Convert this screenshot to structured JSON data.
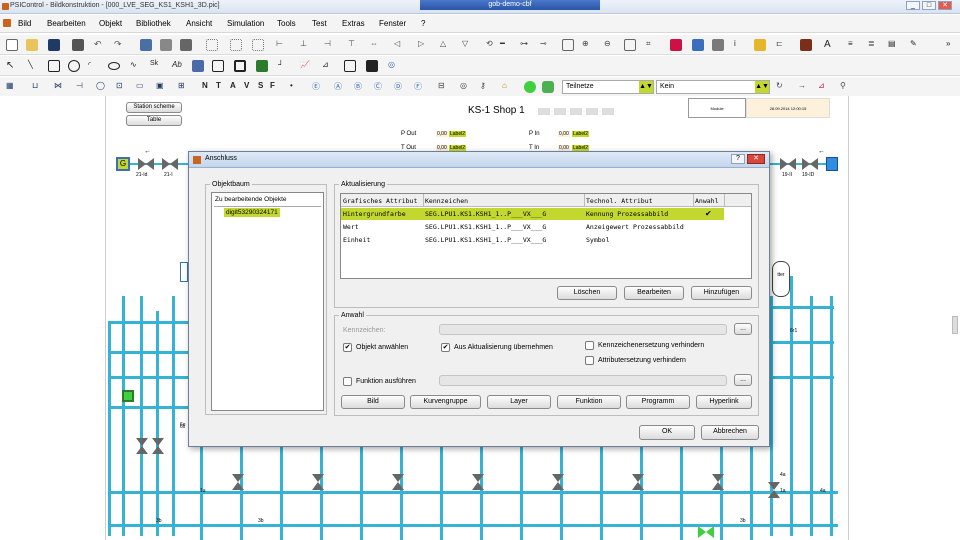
{
  "window": {
    "title": "PSIControl - Bildkonstruktion - [000_LVE_SEG_KS1_KSH1_3D.pic]",
    "remote_title": "gob-demo-cbf"
  },
  "menu": [
    "Bild",
    "Bearbeiten",
    "Objekt",
    "Bibliothek",
    "Ansicht",
    "Simulation",
    "Tools",
    "Test",
    "Extras",
    "Fenster",
    "?"
  ],
  "toolbar3": {
    "text_buttons": [
      "N",
      "T",
      "A",
      "V",
      "S",
      "F"
    ],
    "combo1": "Teilnetze",
    "combo2": "Kein"
  },
  "canvas": {
    "station_button": "Station scheme",
    "table_button": "Table",
    "title": "KS-1 Shop 1",
    "info_left": "Module",
    "info_right": "28.09.2014 12:00:15",
    "p_out_label": "P Out",
    "t_out_label": "T Out",
    "p_in_label": "P In",
    "t_in_label": "T In",
    "value": "0,00",
    "value_label": "Label2",
    "left_nodes": [
      "21-Id",
      "21-I"
    ],
    "right_nodes": [
      "19-II",
      "19-ID"
    ],
    "bottom_labels": [
      "3b",
      "3b",
      "1a",
      "4a",
      "6x",
      "1a",
      "3b",
      "4a",
      "6r1",
      "6e"
    ]
  },
  "dialog": {
    "title": "Anschluss",
    "objektbaum": {
      "legend": "Objektbaum",
      "header": "Zu bearbeitende Objekte",
      "items": [
        "digit53290324171"
      ]
    },
    "aktualisierung": {
      "legend": "Aktualisierung",
      "columns": [
        "Grafisches Attribut",
        "Kennzeichen",
        "Technol. Attribut",
        "Anwahl"
      ],
      "rows": [
        {
          "attr": "Hintergrundfarbe",
          "kenn": "SEG.LPU1.KS1.KSH1_1..P___VX___G",
          "tech": "Kennung Prozessabbild",
          "anwahl": "✔",
          "selected": true
        },
        {
          "attr": "Wert",
          "kenn": "SEG.LPU1.KS1.KSH1_1..P___VX___G",
          "tech": "Anzeigewert Prozessabbild",
          "anwahl": "",
          "selected": false
        },
        {
          "attr": "Einheit",
          "kenn": "SEG.LPU1.KS1.KSH1_1..P___VX___G",
          "tech": "Symbol",
          "anwahl": "",
          "selected": false
        }
      ],
      "buttons": [
        "Löschen",
        "Bearbeiten",
        "Hinzufügen"
      ]
    },
    "anwahl": {
      "legend": "Anwahl",
      "kennzeichen_label": "Kennzeichen:",
      "browse": "...",
      "checkboxes": [
        {
          "label": "Objekt anwählen",
          "checked": true
        },
        {
          "label": "Aus Aktualisierung übernehmen",
          "checked": true
        },
        {
          "label": "Kennzeichenersetzung verhindern",
          "checked": false
        },
        {
          "label": "Attributersetzung verhindern",
          "checked": false
        }
      ],
      "funktion_label": "Funktion ausführen",
      "buttons": [
        "Bild",
        "Kurvengruppe",
        "Layer",
        "Funktion",
        "Programm",
        "Hyperlink"
      ]
    },
    "ok": "OK",
    "cancel": "Abbrechen"
  },
  "colors": {
    "accent_green": "#c3d82e",
    "pipe": "#34b3d4",
    "node_green": "#3fcf3f",
    "node_blue": "#2f8ee0"
  }
}
